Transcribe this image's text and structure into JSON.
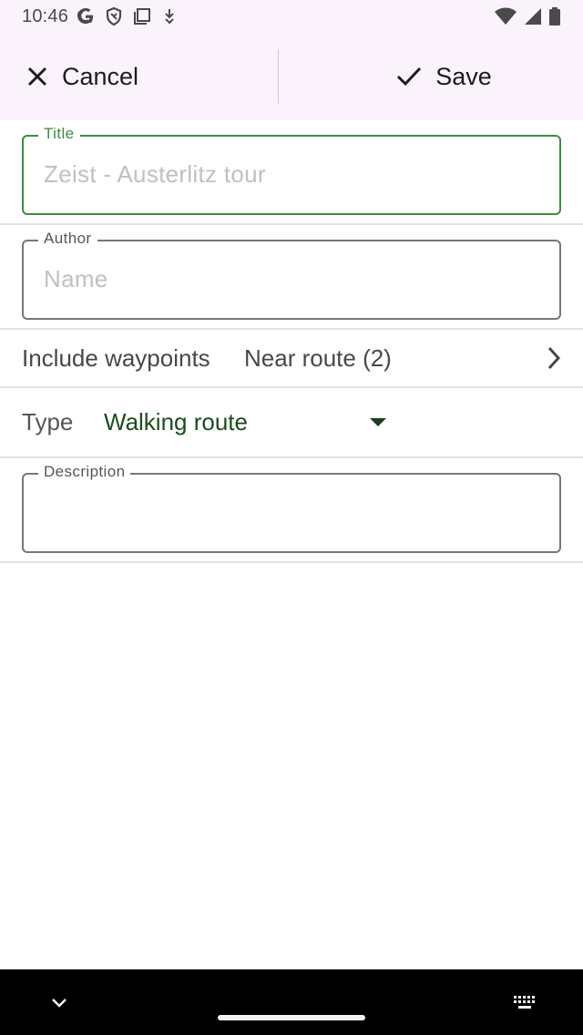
{
  "status_bar": {
    "time": "10:46",
    "icons": [
      "google-icon",
      "shield-icon",
      "screen-icon",
      "download-icon",
      "wifi-icon",
      "signal-icon",
      "battery-icon"
    ]
  },
  "action_bar": {
    "cancel_label": "Cancel",
    "save_label": "Save"
  },
  "form": {
    "title": {
      "label": "Title",
      "placeholder": "Zeist - Austerlitz tour"
    },
    "author": {
      "label": "Author",
      "placeholder": "Name"
    },
    "waypoints": {
      "label": "Include waypoints",
      "value": "Near route (2)"
    },
    "type": {
      "label": "Type",
      "value": "Walking route"
    },
    "description": {
      "label": "Description",
      "value": ""
    }
  },
  "colors": {
    "accent_green": "#3f8a3f",
    "header_bg": "#fbf3fc",
    "type_value": "#1d4d1d"
  }
}
